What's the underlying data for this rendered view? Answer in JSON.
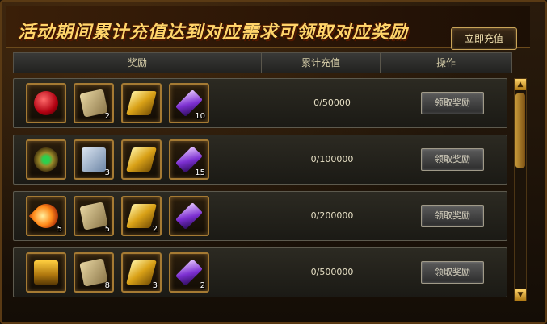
{
  "title": "活动期间累计充值达到对应需求可领取对应奖励",
  "recharge_button": "立即充值",
  "headers": {
    "reward": "奖励",
    "cumulative": "累计充值",
    "action": "操作"
  },
  "rows": [
    {
      "items": [
        {
          "icon": "red-orb-icon",
          "count": ""
        },
        {
          "icon": "scroll-icon",
          "count": "2"
        },
        {
          "icon": "gold-bar-icon",
          "count": ""
        },
        {
          "icon": "purple-gem-icon",
          "count": "10"
        }
      ],
      "progress": "0/50000",
      "claim": "领取奖励"
    },
    {
      "items": [
        {
          "icon": "green-ring-icon",
          "count": ""
        },
        {
          "icon": "blue-book-icon",
          "count": "3"
        },
        {
          "icon": "gold-bar-icon",
          "count": ""
        },
        {
          "icon": "purple-gem-icon",
          "count": "15"
        }
      ],
      "progress": "0/100000",
      "claim": "领取奖励"
    },
    {
      "items": [
        {
          "icon": "fire-crystal-icon",
          "count": "5"
        },
        {
          "icon": "scroll-bundle-icon",
          "count": "5"
        },
        {
          "icon": "gold-bar-icon",
          "count": "2"
        },
        {
          "icon": "purple-gem-icon",
          "count": ""
        }
      ],
      "progress": "0/200000",
      "claim": "领取奖励"
    },
    {
      "items": [
        {
          "icon": "treasure-chest-icon",
          "count": ""
        },
        {
          "icon": "scroll-icon",
          "count": "8"
        },
        {
          "icon": "gold-bar-icon",
          "count": "3"
        },
        {
          "icon": "purple-gem-icon",
          "count": "2"
        }
      ],
      "progress": "0/500000",
      "claim": "领取奖励"
    }
  ],
  "scroll_up_glyph": "▲",
  "scroll_down_glyph": "▼"
}
